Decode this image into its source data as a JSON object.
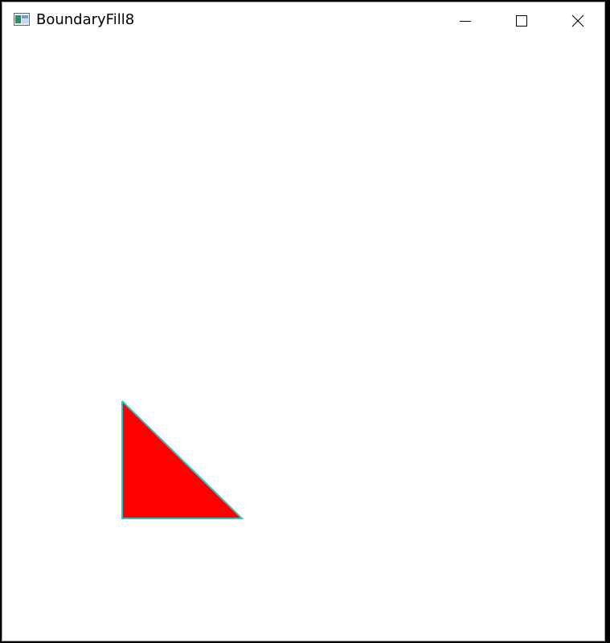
{
  "window": {
    "title": "BoundaryFill8",
    "controls": {
      "minimize_icon": "minimize-icon",
      "maximize_icon": "maximize-icon",
      "close_icon": "close-icon"
    }
  },
  "canvas": {
    "background": "#ffffff",
    "shape": {
      "type": "right-triangle",
      "fill_color": "#ff0000",
      "boundary_color": "#2ec4c4"
    }
  }
}
